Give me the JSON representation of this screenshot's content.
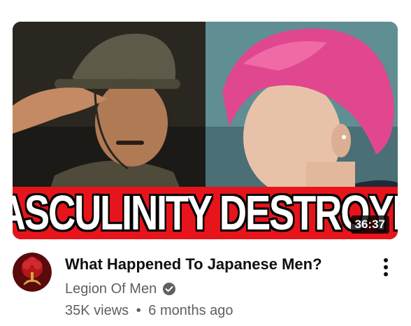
{
  "video": {
    "thumbnail_caption": "MASCULINITY DESTROYED",
    "duration": "36:37",
    "title": "What Happened To Japanese Men?",
    "views": "35K views",
    "separator": "•",
    "age": "6 months ago"
  },
  "channel": {
    "name": "Legion Of Men",
    "verified": true
  },
  "menu": {
    "icon": "more-vert-icon"
  },
  "colors": {
    "banner_red": "#e8141b",
    "title_text": "#0f0f0f",
    "secondary_text": "#606060"
  }
}
